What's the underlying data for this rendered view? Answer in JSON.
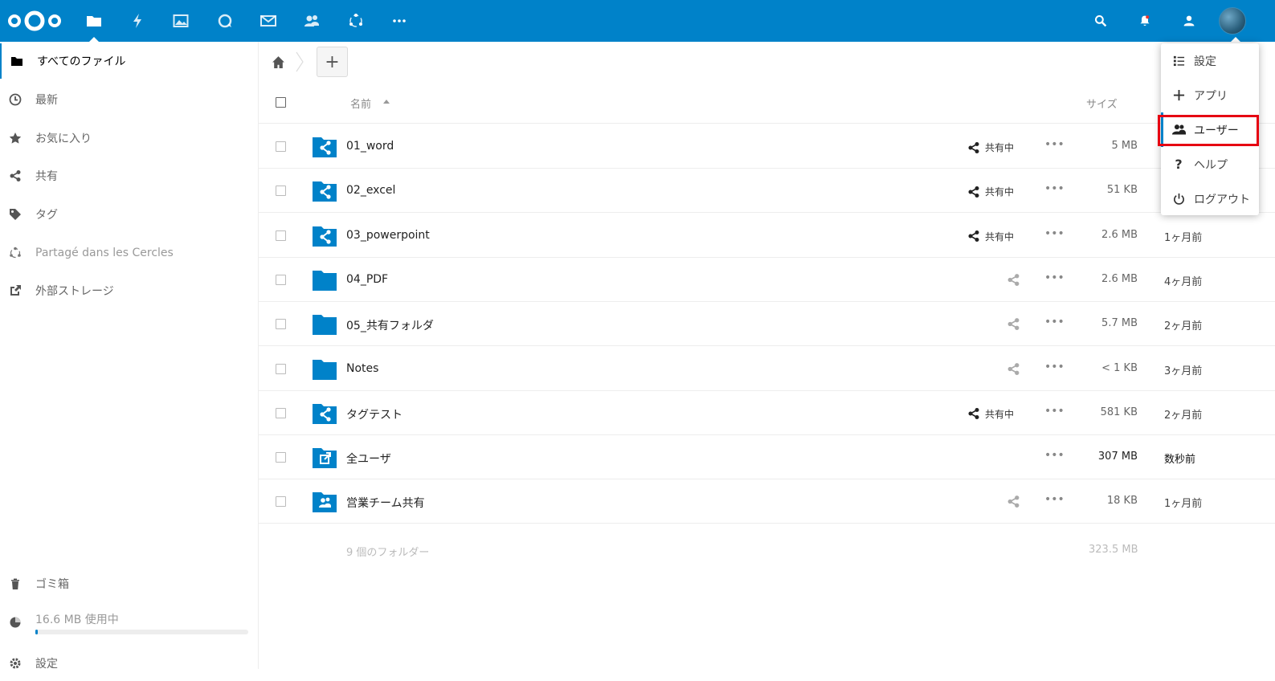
{
  "header": {
    "apps": [
      "files-icon",
      "activity-icon",
      "gallery-icon",
      "talk-icon",
      "mail-icon",
      "contacts-icon",
      "circles-icon",
      "more-apps-icon"
    ],
    "accent_color": "#0082c9"
  },
  "sidebar": {
    "items": [
      {
        "label": "すべてのファイル",
        "icon": "folder-icon"
      },
      {
        "label": "最新",
        "icon": "clock-icon"
      },
      {
        "label": "お気に入り",
        "icon": "star-icon"
      },
      {
        "label": "共有",
        "icon": "share-icon"
      },
      {
        "label": "タグ",
        "icon": "tag-icon"
      },
      {
        "label": "Partagé dans les Cercles",
        "icon": "circles-icon"
      },
      {
        "label": "外部ストレージ",
        "icon": "external-link-icon"
      }
    ],
    "trash_label": "ゴミ箱",
    "quota_label": "16.6 MB 使用中",
    "quota_fraction": 0.01,
    "settings_label": "設定"
  },
  "table": {
    "col_name": "名前",
    "col_size": "サイズ",
    "rows": [
      {
        "name": "01_word",
        "type": "shared",
        "shared_label": "共有中",
        "size": "5 MB",
        "date": ""
      },
      {
        "name": "02_excel",
        "type": "shared",
        "shared_label": "共有中",
        "size": "51 KB",
        "date": ""
      },
      {
        "name": "03_powerpoint",
        "type": "shared",
        "shared_label": "共有中",
        "size": "2.6 MB",
        "date": "1ヶ月前"
      },
      {
        "name": "04_PDF",
        "type": "plain",
        "shared_label": "",
        "size": "2.6 MB",
        "date": "4ヶ月前"
      },
      {
        "name": "05_共有フォルダ",
        "type": "plain",
        "shared_label": "",
        "size": "5.7 MB",
        "date": "2ヶ月前"
      },
      {
        "name": "Notes",
        "type": "plain",
        "shared_label": "",
        "size": "< 1 KB",
        "date": "3ヶ月前"
      },
      {
        "name": "タグテスト",
        "type": "shared",
        "shared_label": "共有中",
        "size": "581 KB",
        "date": "2ヶ月前"
      },
      {
        "name": "全ユーザ",
        "type": "external",
        "shared_label": "",
        "size": "307 MB",
        "date": "数秒前"
      },
      {
        "name": "営業チーム共有",
        "type": "group",
        "shared_label": "",
        "size": "18 KB",
        "date": "1ヶ月前"
      }
    ],
    "more_label": "•••",
    "summary_text": "9 個のフォルダー",
    "summary_size": "323.5 MB"
  },
  "new_button_label": "+",
  "dropdown": {
    "items": [
      {
        "label": "設定",
        "icon": "settings-list-icon"
      },
      {
        "label": "アプリ",
        "icon": "plus-icon"
      },
      {
        "label": "ユーザー",
        "icon": "users-icon"
      },
      {
        "label": "ヘルプ",
        "icon": "help-icon"
      },
      {
        "label": "ログアウト",
        "icon": "power-icon"
      }
    ]
  },
  "highlight_color": "#e60012"
}
